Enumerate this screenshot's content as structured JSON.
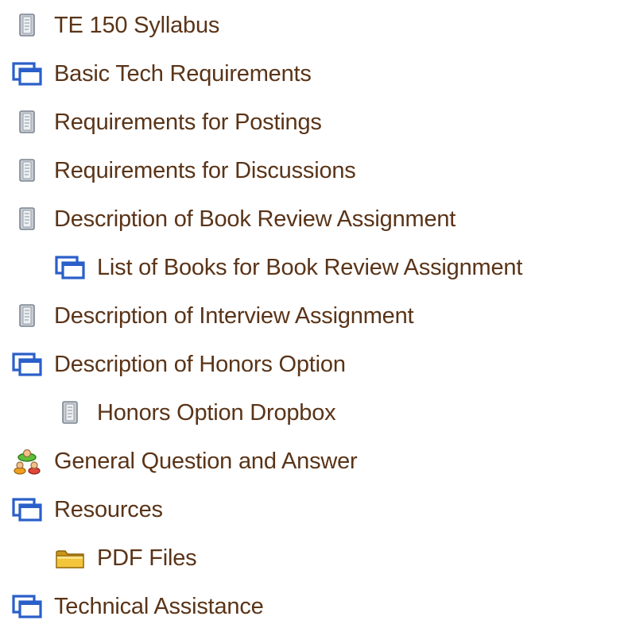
{
  "tree": {
    "items": [
      {
        "label": "TE 150 Syllabus",
        "icon": "document-icon",
        "level": 0
      },
      {
        "label": "Basic Tech Requirements",
        "icon": "window-icon",
        "level": 0
      },
      {
        "label": "Requirements for Postings",
        "icon": "document-icon",
        "level": 0
      },
      {
        "label": "Requirements for Discussions",
        "icon": "document-icon",
        "level": 0
      },
      {
        "label": "Description of Book Review Assignment",
        "icon": "document-icon",
        "level": 0
      },
      {
        "label": "List of Books for Book Review Assignment",
        "icon": "window-icon",
        "level": 1
      },
      {
        "label": "Description of Interview Assignment",
        "icon": "document-icon",
        "level": 0
      },
      {
        "label": "Description of Honors Option",
        "icon": "window-icon",
        "level": 0
      },
      {
        "label": "Honors Option Dropbox",
        "icon": "document-icon",
        "level": 1
      },
      {
        "label": "General Question and Answer",
        "icon": "discussion-group-icon",
        "level": 0
      },
      {
        "label": "Resources",
        "icon": "window-icon",
        "level": 0
      },
      {
        "label": "PDF Files",
        "icon": "folder-icon",
        "level": 1
      },
      {
        "label": "Technical Assistance",
        "icon": "window-icon",
        "level": 0
      }
    ]
  },
  "colors": {
    "link_text": "#5a3418",
    "window_blue": "#2a5fc9",
    "folder_gold": "#e3b020"
  }
}
